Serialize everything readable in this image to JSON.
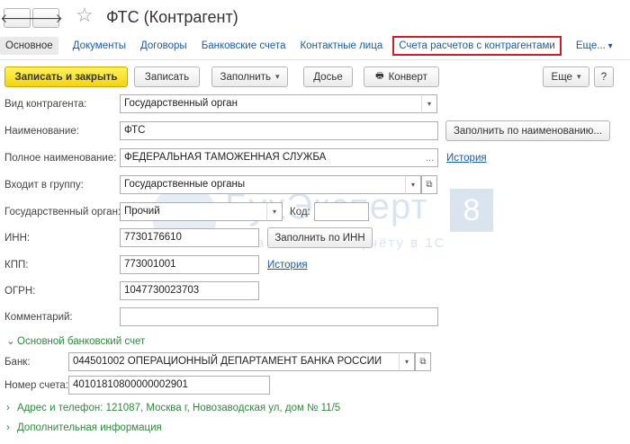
{
  "window": {
    "title": "ФТС (Контрагент)"
  },
  "nav": {
    "back": "🡐",
    "forward": "🡒",
    "favorite": "☆"
  },
  "tabs": [
    {
      "label": "Основное"
    },
    {
      "label": "Документы"
    },
    {
      "label": "Договоры"
    },
    {
      "label": "Банковские счета"
    },
    {
      "label": "Контактные лица"
    },
    {
      "label": "Счета расчетов с контрагентами"
    },
    {
      "label": "Еще..."
    }
  ],
  "toolbar": {
    "save_close": "Записать и закрыть",
    "save": "Записать",
    "fill": "Заполнить",
    "dossier": "Досье",
    "envelope": "Конверт",
    "more": "Еще"
  },
  "form": {
    "kind": {
      "label": "Вид контрагента:",
      "value": "Государственный орган"
    },
    "name": {
      "label": "Наименование:",
      "value": "ФТС",
      "fill_button": "Заполнить по наименованию..."
    },
    "full_name": {
      "label": "Полное наименование:",
      "value": "ФЕДЕРАЛЬНАЯ ТАМОЖЕННАЯ СЛУЖБА",
      "history": "История"
    },
    "group": {
      "label": "Входит в группу:",
      "value": "Государственные органы"
    },
    "gov_body": {
      "label": "Государственный орган:",
      "value": "Прочий",
      "code_label": "Код:",
      "code_value": ""
    },
    "inn": {
      "label": "ИНН:",
      "value": "7730176610",
      "fill_button": "Заполнить по ИНН"
    },
    "kpp": {
      "label": "КПП:",
      "value": "773001001",
      "history": "История"
    },
    "ogrn": {
      "label": "ОГРН:",
      "value": "1047730023703"
    },
    "comment": {
      "label": "Комментарий:",
      "value": ""
    },
    "bank_group": {
      "label": "Основной банковский счет"
    },
    "bank": {
      "label": "Банк:",
      "value": "044501002 ОПЕРАЦИОННЫЙ ДЕПАРТАМЕНТ БАНКА РОССИИ"
    },
    "account": {
      "label": "Номер счета:",
      "value": "40101810800000002901"
    },
    "address_group": {
      "label": "Адрес и телефон: 121087, Москва г, Новозаводская ул, дом № 11/5"
    },
    "extra_group": {
      "label": "Дополнительная информация"
    }
  },
  "watermark": {
    "main": "БухЭксперт",
    "badge": "8",
    "sub": "База ответов по учёту в 1С"
  }
}
